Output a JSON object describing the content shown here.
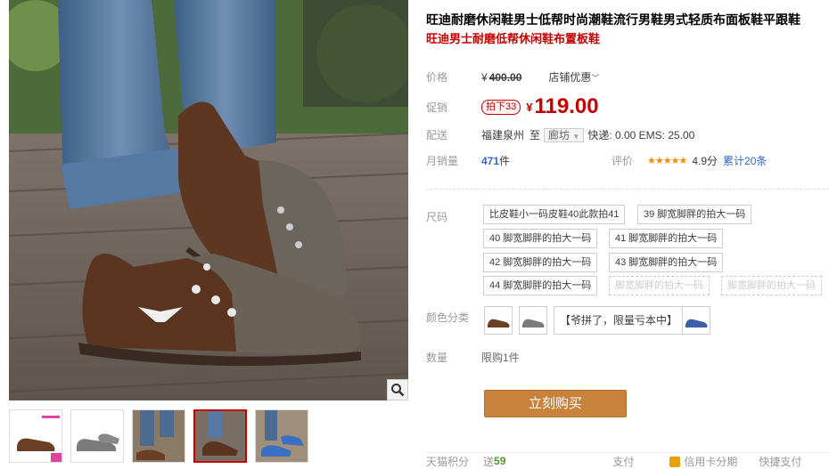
{
  "product": {
    "title": "旺迪耐磨休闲鞋男士低帮时尚潮鞋流行男鞋男式轻质布面板鞋平跟鞋",
    "subtitle": "旺迪男士耐磨低帮休闲鞋布置板鞋"
  },
  "price": {
    "label": "价格",
    "currency": "¥",
    "original": "400.00",
    "coupon_label": "店铺优惠",
    "coupon_icon": "chevron-down-icon"
  },
  "promo": {
    "label": "促销",
    "tag": "拍下33",
    "currency": "¥",
    "price": "119.00"
  },
  "shipping": {
    "label": "配送",
    "from": "福建泉州",
    "to_word": "至",
    "destination": "廊坊",
    "fees": "快递: 0.00 EMS: 25.00"
  },
  "sales": {
    "label": "月销量",
    "count": "471",
    "unit": "件",
    "rating_label": "评价",
    "stars": "★★★★★",
    "score": "4.9分",
    "total_reviews": "累计20条"
  },
  "sizes": {
    "label": "尺码",
    "options": [
      {
        "text": "比皮鞋小一码皮鞋40此款拍41",
        "available": true
      },
      {
        "text": "39 脚宽脚胖的拍大一码",
        "available": true
      },
      {
        "text": "40 脚宽脚胖的拍大一码",
        "available": true
      },
      {
        "text": "41 脚宽脚胖的拍大一码",
        "available": true
      },
      {
        "text": "42 脚宽脚胖的拍大一码",
        "available": true
      },
      {
        "text": "43 脚宽脚胖的拍大一码",
        "available": true
      },
      {
        "text": "44 脚宽脚胖的拍大一码",
        "available": true
      },
      {
        "text": "脚宽脚胖的拍大一码",
        "available": false
      },
      {
        "text": "脚宽脚胖的拍大一码",
        "available": false
      }
    ]
  },
  "colors": {
    "label": "颜色分类",
    "text_option": "【爷拼了，限量亏本中】",
    "swatches": [
      "#6b3f26",
      "#7a7a7a",
      "#3b5fa8"
    ]
  },
  "quantity": {
    "label": "数量",
    "limit": "限购1件"
  },
  "buy_button": "立刻购买",
  "footer": {
    "points_label": "天猫积分",
    "points_prefix": "送",
    "points": "59",
    "pay_label": "支付",
    "credit_label": "信用卡分期",
    "quick_label": "快捷支付"
  },
  "colors_theme": {
    "accent": "#c40000",
    "buy_button": "#c9823b",
    "link_blue": "#3366cc"
  }
}
